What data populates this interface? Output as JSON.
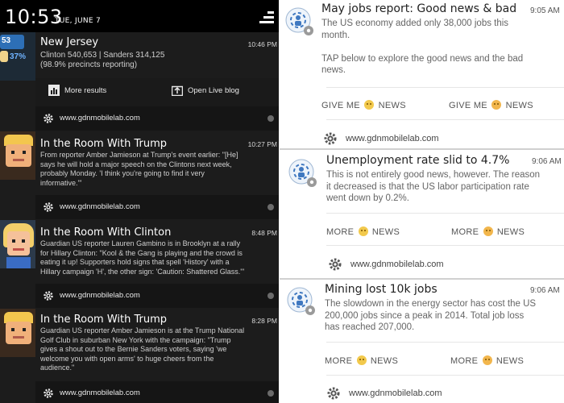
{
  "status": {
    "time": "10:53",
    "date": "TUE, JUNE 7"
  },
  "left": {
    "nj": {
      "badge_top": "53",
      "badge_pct": "37%",
      "title": "New Jersey",
      "time": "10:46 PM",
      "lines": [
        "Clinton 540,653 | Sanders 314,125",
        "(98.9% precincts reporting)"
      ],
      "actions": [
        "More results",
        "Open Live blog"
      ],
      "site": "www.gdnmobilelab.com"
    },
    "cards": [
      {
        "title": "In the Room With Trump",
        "time": "10:27 PM",
        "lines": [
          "From reporter Amber Jamieson at Trump's event earlier: \"[He]",
          "says he will hold a major speech on the Clintons next week,",
          "probably Monday. 'I think you're going to find it very",
          "informative.'\""
        ],
        "site": "www.gdnmobilelab.com"
      },
      {
        "title": "In the Room With Clinton",
        "time": "8:48 PM",
        "lines": [
          "Guardian US reporter Lauren Gambino is in Brooklyn at a rally",
          "for Hillary Clinton: \"Kool & the Gang is playing and the crowd is",
          "eating it up! Supporters hold signs that spell 'History' with a",
          "Hillary campaign 'H', the other sign: 'Caution: Shattered Glass.'\""
        ],
        "site": "www.gdnmobilelab.com"
      },
      {
        "title": "In the Room With Trump",
        "time": "8:28 PM",
        "lines": [
          "Guardian US reporter Amber Jamieson is at the Trump National",
          "Golf Club in suburban New York with the campaign: \"Trump",
          "gives a shout out to the Bernie Sanders voters, saying 'we",
          "welcome you with open arms' to huge cheers from the",
          "audience.\""
        ],
        "site": "www.gdnmobilelab.com"
      }
    ]
  },
  "right": {
    "cards": [
      {
        "title": "May jobs report: Good news & bad",
        "time": "9:05 AM",
        "lines": [
          "The US economy added only 38,000 jobs this",
          "month.",
          "",
          "TAP below to explore the good news and the bad",
          "news."
        ],
        "btn1": [
          "GIVE ME",
          "NEWS"
        ],
        "btn2": [
          "GIVE ME",
          "NEWS"
        ],
        "site": "www.gdnmobilelab.com"
      },
      {
        "title": "Unemployment rate slid to 4.7%",
        "time": "9:06 AM",
        "lines": [
          "This is not entirely good news, however. The reason",
          "it decreased is that the US labor participation rate",
          "went down by 0.2%."
        ],
        "btn1": [
          "MORE",
          "NEWS"
        ],
        "btn2": [
          "MORE",
          "NEWS"
        ],
        "site": "www.gdnmobilelab.com"
      },
      {
        "title": "Mining lost 10k jobs",
        "time": "9:06 AM",
        "lines": [
          "The slowdown in the energy sector has cost the US",
          "200,000 jobs since a peak in 2014. Total job loss",
          "has reached 207,000."
        ],
        "btn1": [
          "MORE",
          "NEWS"
        ],
        "btn2": [
          "MORE",
          "NEWS"
        ],
        "site": "www.gdnmobilelab.com"
      }
    ]
  }
}
